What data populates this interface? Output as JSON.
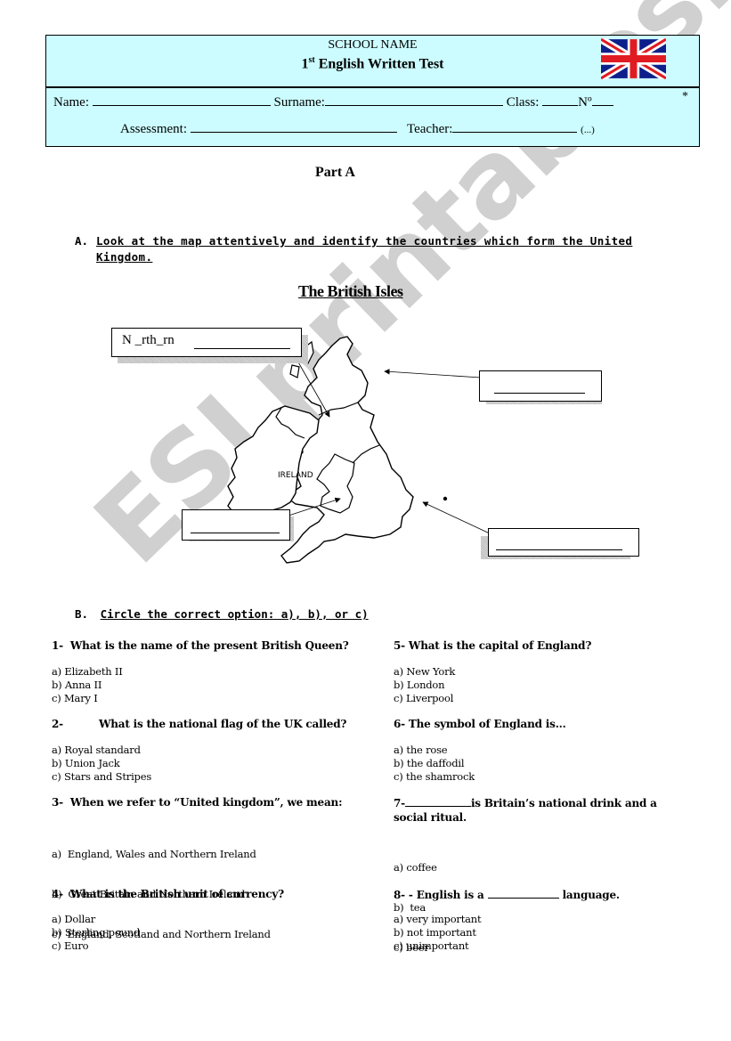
{
  "header": {
    "school_name": "SCHOOL NAME",
    "test_number": "1",
    "test_suffix": "st",
    "test_title": " English Written Test",
    "flag_icon": "union-jack-flag",
    "fields": {
      "name": "Name:",
      "surname": "Surname:",
      "class": "Class:",
      "number": "Nº",
      "asterisk": "*",
      "assessment": "Assessment:",
      "teacher": "Teacher:",
      "ellipsis": "(...)"
    }
  },
  "part_title": "Part A",
  "section_a": {
    "label": "A.",
    "instruction_line1": "Look at the map attentively and identify the countries which form the United",
    "instruction_line2": "Kingdom.",
    "map_title": "The British Isles",
    "map_label_ireland": "IRELAND",
    "label_boxes": [
      {
        "prefix": "N _rth_rn",
        "target": "northern-ireland"
      },
      {
        "prefix": "",
        "target": "scotland"
      },
      {
        "prefix": "",
        "target": "wales"
      },
      {
        "prefix": "",
        "target": "england"
      }
    ]
  },
  "section_b": {
    "label": "B.",
    "instruction": "Circle the correct option: a), b), or c)",
    "questions": [
      {
        "number": "1-",
        "text": "What is the name of the present British Queen?",
        "options": [
          "a) Elizabeth II",
          "b) Anna II",
          "c) Mary I"
        ]
      },
      {
        "number": "2-",
        "text": "What is the national flag of the UK called?",
        "options": [
          "a) Royal standard",
          "b) Union Jack",
          "c) Stars and Stripes"
        ]
      },
      {
        "number": "3-",
        "text": "When we refer to “United kingdom”, we mean:",
        "options": [
          "a)  England, Wales and Northern Ireland",
          "b)  Great Britain and Northern Ireland",
          "c)  England, Scotland and Northern Ireland"
        ]
      },
      {
        "number": "4-",
        "text": "What is the British unit of currency?",
        "options": [
          "a) Dollar",
          "b) Sterling pound",
          "c) Euro"
        ]
      },
      {
        "number": "5-",
        "text": "What is the capital of England?",
        "options": [
          "a) New York",
          "b) London",
          "c) Liverpool"
        ]
      },
      {
        "number": "6-",
        "text": "The symbol of England is...",
        "options": [
          "a) the rose",
          "b) the daffodil",
          "c) the shamrock"
        ]
      },
      {
        "number": "7-",
        "text_after_blank": "is Britain’s national drink and a",
        "text_line2": "social ritual.",
        "options": [
          "a) coffee",
          "b)  tea",
          "c) beer"
        ]
      },
      {
        "number": "8- -",
        "text_before_blank": "English is a",
        "text_after_blank": "language.",
        "options": [
          "a) very important",
          "b) not important",
          "c) unimportant"
        ]
      }
    ]
  },
  "watermark": "ESLprintables.com",
  "colors": {
    "header_bg": "#ccfcff",
    "flag_blue": "#0c1f8a",
    "flag_red": "#e11b22"
  }
}
